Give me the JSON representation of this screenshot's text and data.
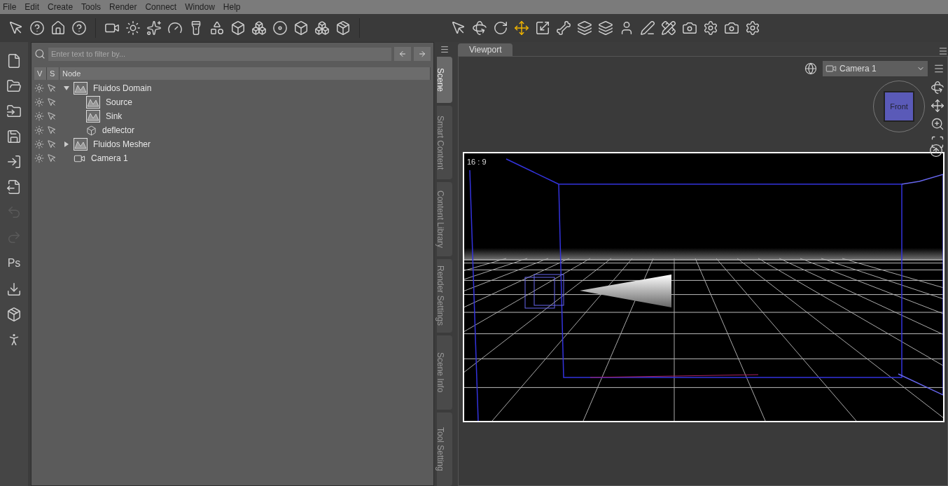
{
  "menu": [
    "File",
    "Edit",
    "Create",
    "Tools",
    "Render",
    "Connect",
    "Window",
    "Help"
  ],
  "left_tools": {
    "export_label": "Ps"
  },
  "scene": {
    "filter": {
      "placeholder": "Enter text to filter by..."
    },
    "columns": [
      "V",
      "S",
      "Node"
    ],
    "nodes": [
      {
        "name": "Fluidos Domain",
        "kind": "sim",
        "expanded": true,
        "children": [
          {
            "name": "Source",
            "kind": "sim"
          },
          {
            "name": "Sink",
            "kind": "sim"
          },
          {
            "name": "deflector",
            "kind": "cube"
          }
        ]
      },
      {
        "name": "Fluidos Mesher",
        "kind": "sim",
        "expanded": false
      },
      {
        "name": "Camera 1",
        "kind": "camera"
      }
    ]
  },
  "side_tabs": [
    {
      "label": "Scene",
      "selected": true
    },
    {
      "label": "Smart Content",
      "selected": false
    },
    {
      "label": "Content Library",
      "selected": false
    },
    {
      "label": "Render Settings",
      "selected": false
    },
    {
      "label": "Scene Info",
      "selected": false
    },
    {
      "label": "Tool Setting",
      "selected": false
    }
  ],
  "viewport": {
    "tab": "Viewport",
    "camera": "Camera 1",
    "cube_face": "Front",
    "aspect": "16 : 9"
  }
}
